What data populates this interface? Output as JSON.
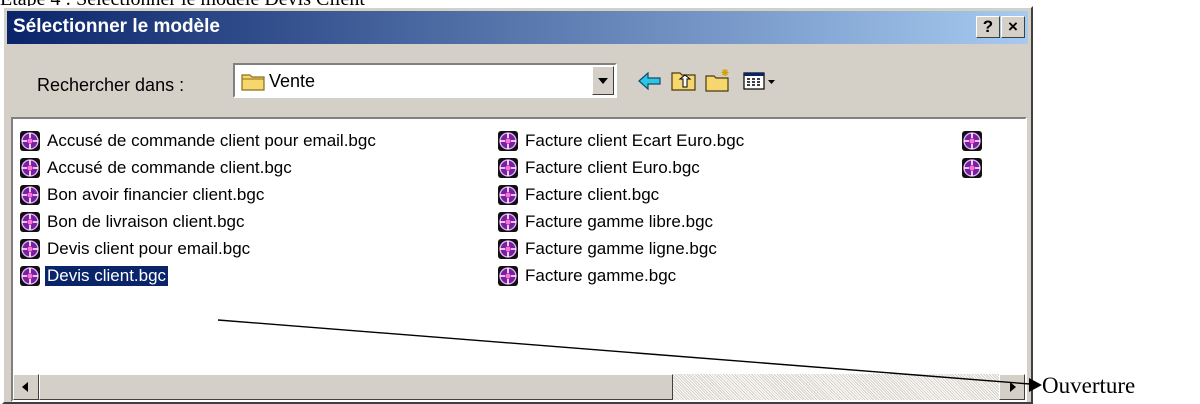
{
  "document": {
    "heading": "Etape 4 : Sélectionner le modèle Devis Client",
    "annotation_label": "Ouverture"
  },
  "dialog": {
    "title": "Sélectionner le modèle",
    "help_label": "?",
    "close_label": "×",
    "look_in_label": "Rechercher dans :",
    "look_in_value": "Vente",
    "files": [
      {
        "name": "Accusé de commande client pour email.bgc",
        "selected": false
      },
      {
        "name": "Accusé de commande client.bgc",
        "selected": false
      },
      {
        "name": "Bon avoir financier client.bgc",
        "selected": false
      },
      {
        "name": "Bon de livraison client.bgc",
        "selected": false
      },
      {
        "name": "Devis client pour email.bgc",
        "selected": false
      },
      {
        "name": "Devis client.bgc",
        "selected": true
      },
      {
        "name": "Facture client Ecart Euro.bgc",
        "selected": false
      },
      {
        "name": "Facture client Euro.bgc",
        "selected": false
      },
      {
        "name": "Facture client.bgc",
        "selected": false
      },
      {
        "name": "Facture gamme libre.bgc",
        "selected": false
      },
      {
        "name": "Facture gamme ligne.bgc",
        "selected": false
      },
      {
        "name": "Facture gamme.bgc",
        "selected": false
      },
      {
        "name": "",
        "selected": false
      },
      {
        "name": "",
        "selected": false
      }
    ],
    "icons": {
      "folder": "folder-icon",
      "back": "back-arrow-icon",
      "up": "up-folder-icon",
      "new_folder": "new-folder-icon",
      "view_menu": "view-menu-icon",
      "file": "template-file-icon"
    },
    "colors": {
      "titlebar_start": "#0a246a",
      "titlebar_end": "#a6caf0",
      "selection": "#0a246a",
      "face": "#d4d0c8"
    }
  }
}
